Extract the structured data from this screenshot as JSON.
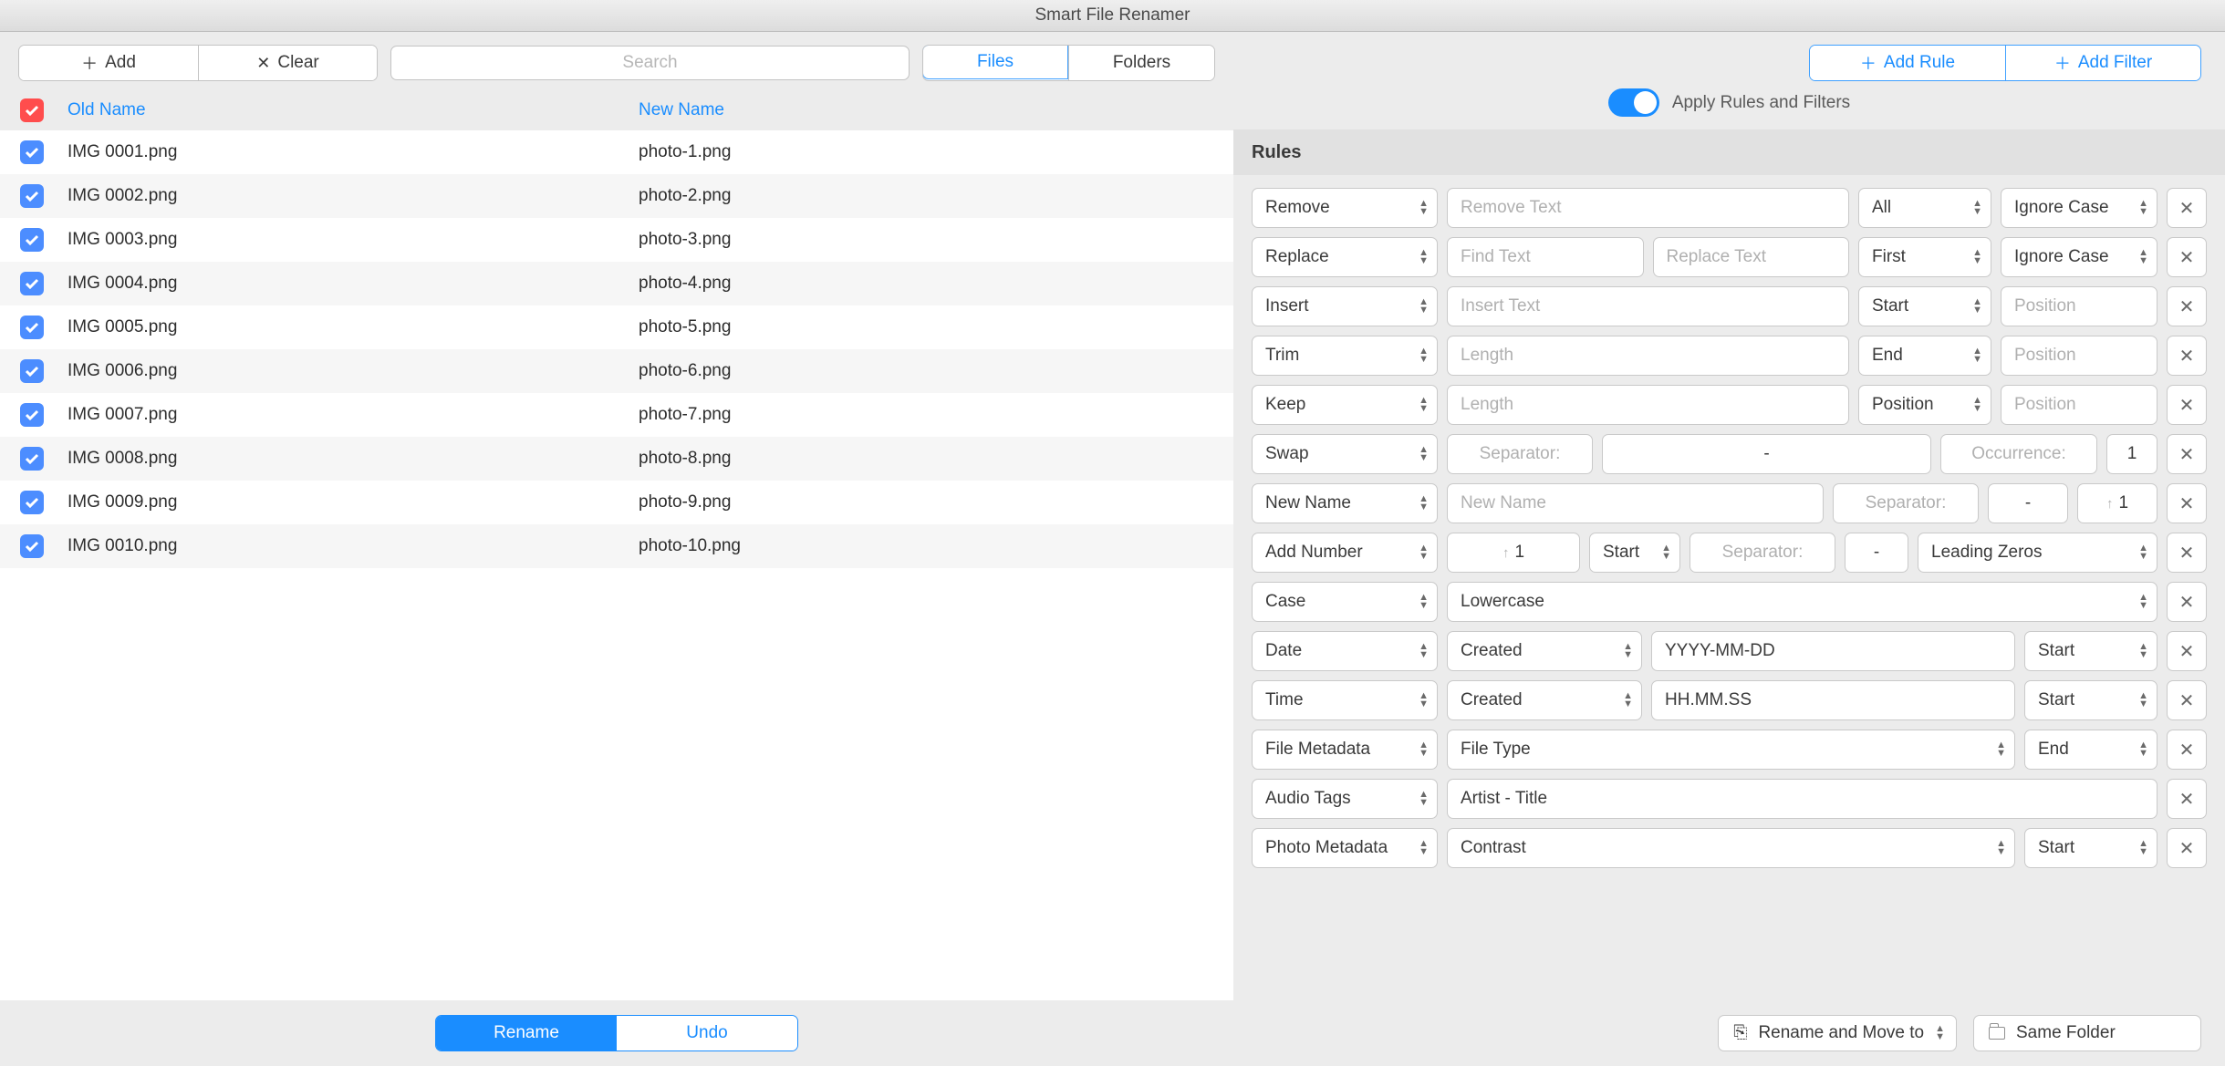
{
  "title": "Smart File Renamer",
  "leftToolbar": {
    "add": "Add",
    "clear": "Clear",
    "searchPlaceholder": "Search",
    "tab_files": "Files",
    "tab_folders": "Folders"
  },
  "table": {
    "header_old": "Old Name",
    "header_new": "New Name",
    "rows": [
      {
        "old": "IMG 0001.png",
        "new": "photo-1.png"
      },
      {
        "old": "IMG 0002.png",
        "new": "photo-2.png"
      },
      {
        "old": "IMG 0003.png",
        "new": "photo-3.png"
      },
      {
        "old": "IMG 0004.png",
        "new": "photo-4.png"
      },
      {
        "old": "IMG 0005.png",
        "new": "photo-5.png"
      },
      {
        "old": "IMG 0006.png",
        "new": "photo-6.png"
      },
      {
        "old": "IMG 0007.png",
        "new": "photo-7.png"
      },
      {
        "old": "IMG 0008.png",
        "new": "photo-8.png"
      },
      {
        "old": "IMG 0009.png",
        "new": "photo-9.png"
      },
      {
        "old": "IMG 0010.png",
        "new": "photo-10.png"
      }
    ]
  },
  "leftFooter": {
    "rename": "Rename",
    "undo": "Undo"
  },
  "rightToolbar": {
    "addRule": "Add Rule",
    "addFilter": "Add Filter",
    "applyLabel": "Apply Rules and Filters"
  },
  "rulesHeader": "Rules",
  "rules": {
    "r0": {
      "op": "Remove",
      "ph1": "Remove Text",
      "sel2": "All",
      "sel3": "Ignore Case"
    },
    "r1": {
      "op": "Replace",
      "ph1": "Find Text",
      "ph2": "Replace Text",
      "sel2": "First",
      "sel3": "Ignore Case"
    },
    "r2": {
      "op": "Insert",
      "ph1": "Insert Text",
      "sel2": "Start",
      "ph3": "Position"
    },
    "r3": {
      "op": "Trim",
      "ph1": "Length",
      "sel2": "End",
      "ph3": "Position"
    },
    "r4": {
      "op": "Keep",
      "ph1": "Length",
      "sel2": "Position",
      "ph3": "Position"
    },
    "r5": {
      "op": "Swap",
      "lbl1": "Separator:",
      "dash": "-",
      "lbl2": "Occurrence:",
      "num": "1"
    },
    "r6": {
      "op": "New Name",
      "ph1": "New Name",
      "lbl2": "Separator:",
      "dash": "-",
      "idx": "1"
    },
    "r7": {
      "op": "Add Number",
      "idx": "1",
      "sel1": "Start",
      "lbl2": "Separator:",
      "dash": "-",
      "sel3": "Leading Zeros"
    },
    "r8": {
      "op": "Case",
      "sel1": "Lowercase"
    },
    "r9": {
      "op": "Date",
      "sel1": "Created",
      "val": "YYYY-MM-DD",
      "sel2": "Start"
    },
    "r10": {
      "op": "Time",
      "sel1": "Created",
      "val": "HH.MM.SS",
      "sel2": "Start"
    },
    "r11": {
      "op": "File Metadata",
      "sel1": "File Type",
      "sel2": "End"
    },
    "r12": {
      "op": "Audio Tags",
      "val": "Artist - Title"
    },
    "r13": {
      "op": "Photo Metadata",
      "sel1": "Contrast",
      "sel2": "Start"
    }
  },
  "rightFooter": {
    "moveTo": "Rename and Move to",
    "sameFolder": "Same Folder"
  }
}
